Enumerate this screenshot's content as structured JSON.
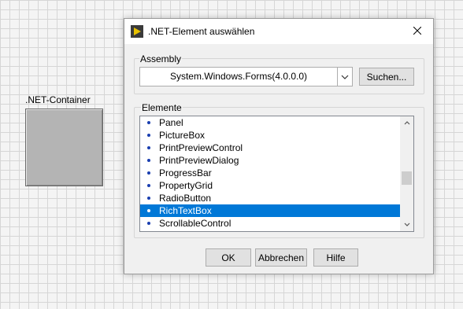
{
  "container": {
    "label": ".NET-Container"
  },
  "dialog": {
    "title": ".NET-Element auswählen",
    "assembly_label": "Assembly",
    "assembly_value": "System.Windows.Forms(4.0.0.0)",
    "search_button": "Suchen...",
    "elements_label": "Elemente",
    "items": [
      {
        "label": "Panel",
        "selected": false
      },
      {
        "label": "PictureBox",
        "selected": false
      },
      {
        "label": "PrintPreviewControl",
        "selected": false
      },
      {
        "label": "PrintPreviewDialog",
        "selected": false
      },
      {
        "label": "ProgressBar",
        "selected": false
      },
      {
        "label": "PropertyGrid",
        "selected": false
      },
      {
        "label": "RadioButton",
        "selected": false
      },
      {
        "label": "RichTextBox",
        "selected": true
      },
      {
        "label": "ScrollableControl",
        "selected": false
      }
    ],
    "ok_button": "OK",
    "cancel_button": "Abbrechen",
    "help_button": "Hilfe"
  },
  "colors": {
    "selection": "#0078d7",
    "bullet": "#1a3fb0",
    "icon_bg": "#3a3a3a",
    "icon_arrow": "#e8c200"
  },
  "icons": {
    "app": "labview-arrow-icon",
    "close": "close-icon",
    "dropdown": "chevron-down-icon"
  }
}
